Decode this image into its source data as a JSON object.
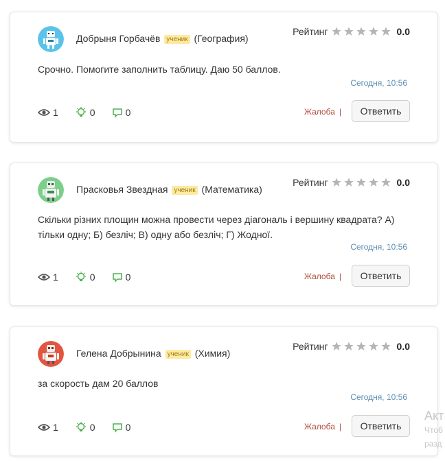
{
  "questions": [
    {
      "author": "Добрыня Горбачёв",
      "badge": "ученик",
      "subject": "(География)",
      "rating_label": "Рейтинг",
      "rating_value": "0.0",
      "text": "Срочно. Помогите заполнить таблицу. Даю 50 баллов.",
      "time": "Сегодня, 10:56",
      "views": "1",
      "ideas": "0",
      "comments": "0",
      "complaint": "Жалоба",
      "answer": "Ответить",
      "avatar_color": "#5bc3ea"
    },
    {
      "author": "Прасковья Звездная",
      "badge": "ученик",
      "subject": "(Математика)",
      "rating_label": "Рейтинг",
      "rating_value": "0.0",
      "text": "Скільки різних площин можна провести через діагональ і вершину квадрата? А) тільки одну; Б) безліч; В) одну або безліч; Г) Жодної.",
      "time": "Сегодня, 10:56",
      "views": "1",
      "ideas": "0",
      "comments": "0",
      "complaint": "Жалоба",
      "answer": "Ответить",
      "avatar_color": "#7ccf8a"
    },
    {
      "author": "Гелена Добрынина",
      "badge": "ученик",
      "subject": "(Химия)",
      "rating_label": "Рейтинг",
      "rating_value": "0.0",
      "text": "за скорость дам 20 баллов",
      "time": "Сегодня, 10:56",
      "views": "1",
      "ideas": "0",
      "comments": "0",
      "complaint": "Жалоба",
      "answer": "Ответить",
      "avatar_color": "#e2553f"
    }
  ],
  "watermark": {
    "line1": "Акт",
    "line2": "Чтоб",
    "line3": "разд"
  },
  "colors": {
    "icon_green": "#4caf50",
    "icon_gray": "#555555",
    "star_gray": "#b5b5b5",
    "time_blue": "#5b8db2",
    "complaint_red": "#b04a3a"
  }
}
